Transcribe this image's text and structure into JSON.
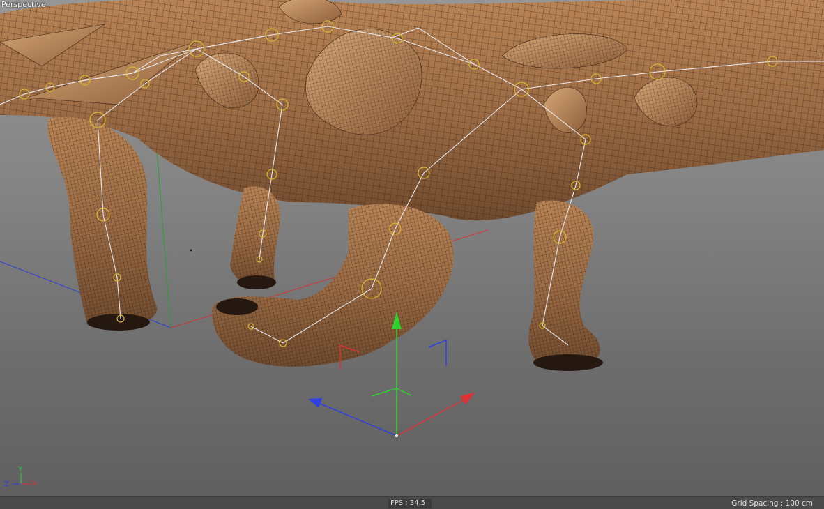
{
  "viewport": {
    "name": "Perspective",
    "fps_label": "FPS : 34.5",
    "grid_spacing_label": "Grid Spacing : 100 cm"
  },
  "axis_indicator": {
    "x": "X",
    "y": "Y",
    "z": "Z"
  },
  "colors": {
    "x_axis": "#e03030",
    "y_axis": "#2fd12f",
    "z_axis": "#3040e0",
    "mesh_fill": "#9a6a45",
    "mesh_wire": "#2b1a10",
    "bone": "#e8e8f0",
    "joint": "#d8b830"
  },
  "icons": [
    "move-gizmo-icon",
    "axis-indicator-icon"
  ]
}
